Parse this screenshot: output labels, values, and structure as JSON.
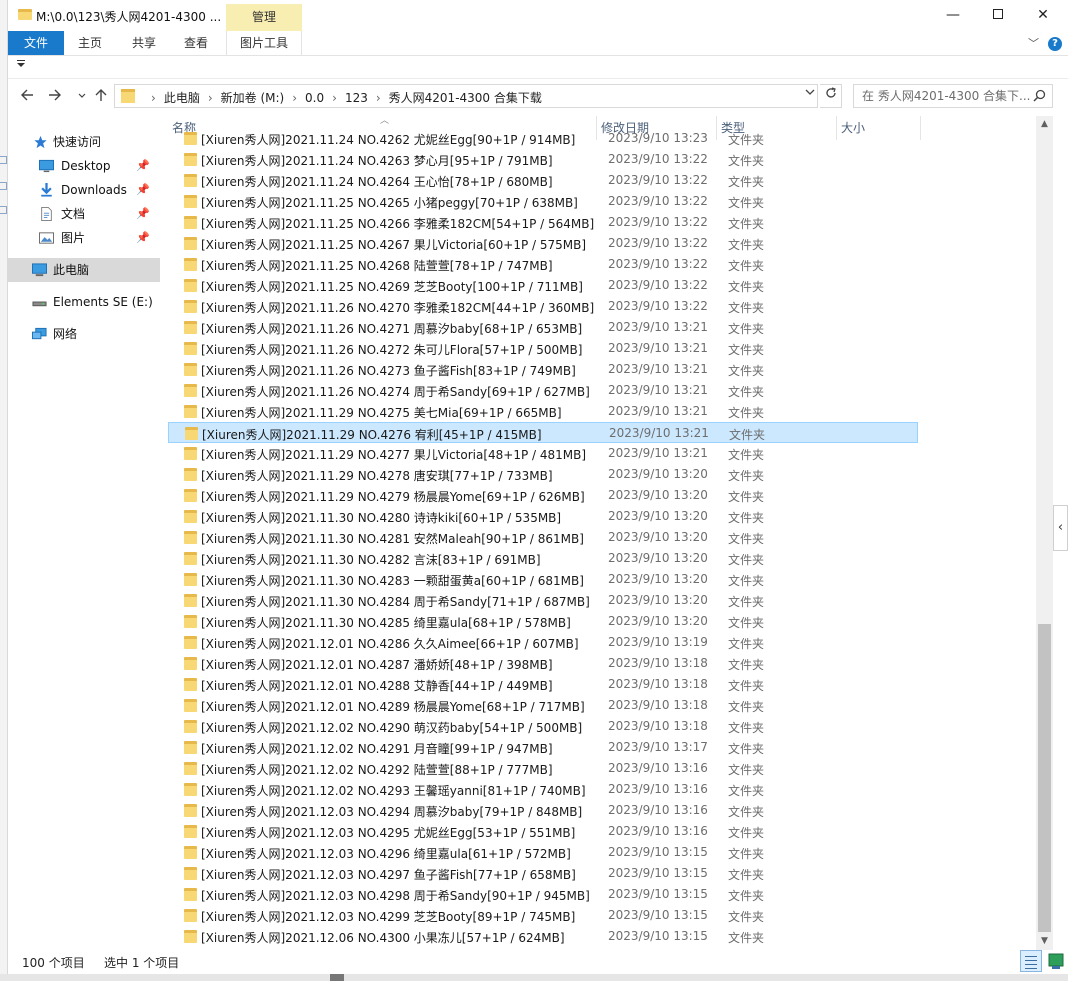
{
  "window": {
    "title": "M:\\0.0\\123\\秀人网4201-4300 ...",
    "context_tab_group": "管理",
    "minimize": "—",
    "maximize": "",
    "close": "✕"
  },
  "ribbon": {
    "tabs": [
      {
        "label": "文件"
      },
      {
        "label": "主页"
      },
      {
        "label": "共享"
      },
      {
        "label": "查看"
      },
      {
        "label": "图片工具"
      }
    ],
    "help": "?"
  },
  "address": {
    "crumbs": [
      "此电脑",
      "新加卷 (M:)",
      "0.0",
      "123",
      "秀人网4201-4300 合集下载"
    ],
    "search_placeholder": "在 秀人网4201-4300 合集下..."
  },
  "nav_pane": {
    "items": [
      {
        "label": "快速访问",
        "icon": "star-icon"
      },
      {
        "label": "Desktop",
        "icon": "desktop-icon",
        "pinned": true
      },
      {
        "label": "Downloads",
        "icon": "download-icon",
        "pinned": true
      },
      {
        "label": "文档",
        "icon": "document-icon",
        "pinned": true
      },
      {
        "label": "图片",
        "icon": "picture-icon",
        "pinned": true
      },
      {
        "label": "此电脑",
        "icon": "computer-icon",
        "selected": true
      },
      {
        "label": "Elements SE (E:)",
        "icon": "drive-icon"
      },
      {
        "label": "网络",
        "icon": "network-icon"
      }
    ]
  },
  "columns": {
    "name": "名称",
    "modified": "修改日期",
    "type": "类型",
    "size": "大小"
  },
  "files": [
    {
      "name": "[Xiuren秀人网]2021.11.24 NO.4262 尤妮丝Egg[90+1P / 914MB]",
      "modified": "2023/9/10 13:23",
      "type": "文件夹"
    },
    {
      "name": "[Xiuren秀人网]2021.11.24 NO.4263 梦心月[95+1P / 791MB]",
      "modified": "2023/9/10 13:22",
      "type": "文件夹"
    },
    {
      "name": "[Xiuren秀人网]2021.11.24 NO.4264 王心怡[78+1P / 680MB]",
      "modified": "2023/9/10 13:22",
      "type": "文件夹"
    },
    {
      "name": "[Xiuren秀人网]2021.11.25 NO.4265 小猪peggy[70+1P / 638MB]",
      "modified": "2023/9/10 13:22",
      "type": "文件夹"
    },
    {
      "name": "[Xiuren秀人网]2021.11.25 NO.4266 李雅柔182CM[54+1P / 564MB]",
      "modified": "2023/9/10 13:22",
      "type": "文件夹"
    },
    {
      "name": "[Xiuren秀人网]2021.11.25 NO.4267 果儿Victoria[60+1P / 575MB]",
      "modified": "2023/9/10 13:22",
      "type": "文件夹"
    },
    {
      "name": "[Xiuren秀人网]2021.11.25 NO.4268 陆萱萱[78+1P / 747MB]",
      "modified": "2023/9/10 13:22",
      "type": "文件夹"
    },
    {
      "name": "[Xiuren秀人网]2021.11.25 NO.4269 芝芝Booty[100+1P / 711MB]",
      "modified": "2023/9/10 13:22",
      "type": "文件夹"
    },
    {
      "name": "[Xiuren秀人网]2021.11.26 NO.4270 李雅柔182CM[44+1P / 360MB]",
      "modified": "2023/9/10 13:22",
      "type": "文件夹"
    },
    {
      "name": "[Xiuren秀人网]2021.11.26 NO.4271 周慕汐baby[68+1P / 653MB]",
      "modified": "2023/9/10 13:21",
      "type": "文件夹"
    },
    {
      "name": "[Xiuren秀人网]2021.11.26 NO.4272 朱可儿Flora[57+1P / 500MB]",
      "modified": "2023/9/10 13:21",
      "type": "文件夹"
    },
    {
      "name": "[Xiuren秀人网]2021.11.26 NO.4273 鱼子酱Fish[83+1P / 749MB]",
      "modified": "2023/9/10 13:21",
      "type": "文件夹"
    },
    {
      "name": "[Xiuren秀人网]2021.11.26 NO.4274 周于希Sandy[69+1P / 627MB]",
      "modified": "2023/9/10 13:21",
      "type": "文件夹"
    },
    {
      "name": "[Xiuren秀人网]2021.11.29 NO.4275 美七Mia[69+1P / 665MB]",
      "modified": "2023/9/10 13:21",
      "type": "文件夹"
    },
    {
      "name": "[Xiuren秀人网]2021.11.29 NO.4276 宥利[45+1P / 415MB]",
      "modified": "2023/9/10 13:21",
      "type": "文件夹",
      "selected": true
    },
    {
      "name": "[Xiuren秀人网]2021.11.29 NO.4277 果儿Victoria[48+1P / 481MB]",
      "modified": "2023/9/10 13:21",
      "type": "文件夹"
    },
    {
      "name": "[Xiuren秀人网]2021.11.29 NO.4278 唐安琪[77+1P / 733MB]",
      "modified": "2023/9/10 13:20",
      "type": "文件夹"
    },
    {
      "name": "[Xiuren秀人网]2021.11.29 NO.4279 杨晨晨Yome[69+1P / 626MB]",
      "modified": "2023/9/10 13:20",
      "type": "文件夹"
    },
    {
      "name": "[Xiuren秀人网]2021.11.30 NO.4280 诗诗kiki[60+1P / 535MB]",
      "modified": "2023/9/10 13:20",
      "type": "文件夹"
    },
    {
      "name": "[Xiuren秀人网]2021.11.30 NO.4281 安然Maleah[90+1P / 861MB]",
      "modified": "2023/9/10 13:20",
      "type": "文件夹"
    },
    {
      "name": "[Xiuren秀人网]2021.11.30 NO.4282 言沫[83+1P / 691MB]",
      "modified": "2023/9/10 13:20",
      "type": "文件夹"
    },
    {
      "name": "[Xiuren秀人网]2021.11.30 NO.4283 一颗甜蛋黄a[60+1P / 681MB]",
      "modified": "2023/9/10 13:20",
      "type": "文件夹"
    },
    {
      "name": "[Xiuren秀人网]2021.11.30 NO.4284 周于希Sandy[71+1P / 687MB]",
      "modified": "2023/9/10 13:20",
      "type": "文件夹"
    },
    {
      "name": "[Xiuren秀人网]2021.11.30 NO.4285 绮里嘉ula[68+1P / 578MB]",
      "modified": "2023/9/10 13:20",
      "type": "文件夹"
    },
    {
      "name": "[Xiuren秀人网]2021.12.01 NO.4286 久久Aimee[66+1P / 607MB]",
      "modified": "2023/9/10 13:19",
      "type": "文件夹"
    },
    {
      "name": "[Xiuren秀人网]2021.12.01 NO.4287 潘娇娇[48+1P / 398MB]",
      "modified": "2023/9/10 13:18",
      "type": "文件夹"
    },
    {
      "name": "[Xiuren秀人网]2021.12.01 NO.4288 艾静香[44+1P / 449MB]",
      "modified": "2023/9/10 13:18",
      "type": "文件夹"
    },
    {
      "name": "[Xiuren秀人网]2021.12.01 NO.4289 杨晨晨Yome[68+1P / 717MB]",
      "modified": "2023/9/10 13:18",
      "type": "文件夹"
    },
    {
      "name": "[Xiuren秀人网]2021.12.02 NO.4290 萌汉药baby[54+1P / 500MB]",
      "modified": "2023/9/10 13:18",
      "type": "文件夹"
    },
    {
      "name": "[Xiuren秀人网]2021.12.02 NO.4291 月音瞳[99+1P / 947MB]",
      "modified": "2023/9/10 13:17",
      "type": "文件夹"
    },
    {
      "name": "[Xiuren秀人网]2021.12.02 NO.4292 陆萱萱[88+1P / 777MB]",
      "modified": "2023/9/10 13:16",
      "type": "文件夹"
    },
    {
      "name": "[Xiuren秀人网]2021.12.02 NO.4293 王馨瑶yanni[81+1P / 740MB]",
      "modified": "2023/9/10 13:16",
      "type": "文件夹"
    },
    {
      "name": "[Xiuren秀人网]2021.12.03 NO.4294 周慕汐baby[79+1P / 848MB]",
      "modified": "2023/9/10 13:16",
      "type": "文件夹"
    },
    {
      "name": "[Xiuren秀人网]2021.12.03 NO.4295 尤妮丝Egg[53+1P / 551MB]",
      "modified": "2023/9/10 13:16",
      "type": "文件夹"
    },
    {
      "name": "[Xiuren秀人网]2021.12.03 NO.4296 绮里嘉ula[61+1P / 572MB]",
      "modified": "2023/9/10 13:15",
      "type": "文件夹"
    },
    {
      "name": "[Xiuren秀人网]2021.12.03 NO.4297 鱼子酱Fish[77+1P / 658MB]",
      "modified": "2023/9/10 13:15",
      "type": "文件夹"
    },
    {
      "name": "[Xiuren秀人网]2021.12.03 NO.4298 周于希Sandy[90+1P / 945MB]",
      "modified": "2023/9/10 13:15",
      "type": "文件夹"
    },
    {
      "name": "[Xiuren秀人网]2021.12.03 NO.4299 芝芝Booty[89+1P / 745MB]",
      "modified": "2023/9/10 13:15",
      "type": "文件夹"
    },
    {
      "name": "[Xiuren秀人网]2021.12.06 NO.4300 小果冻儿[57+1P / 624MB]",
      "modified": "2023/9/10 13:15",
      "type": "文件夹"
    }
  ],
  "status": {
    "count": "100 个项目",
    "selected": "选中 1 个项目"
  }
}
